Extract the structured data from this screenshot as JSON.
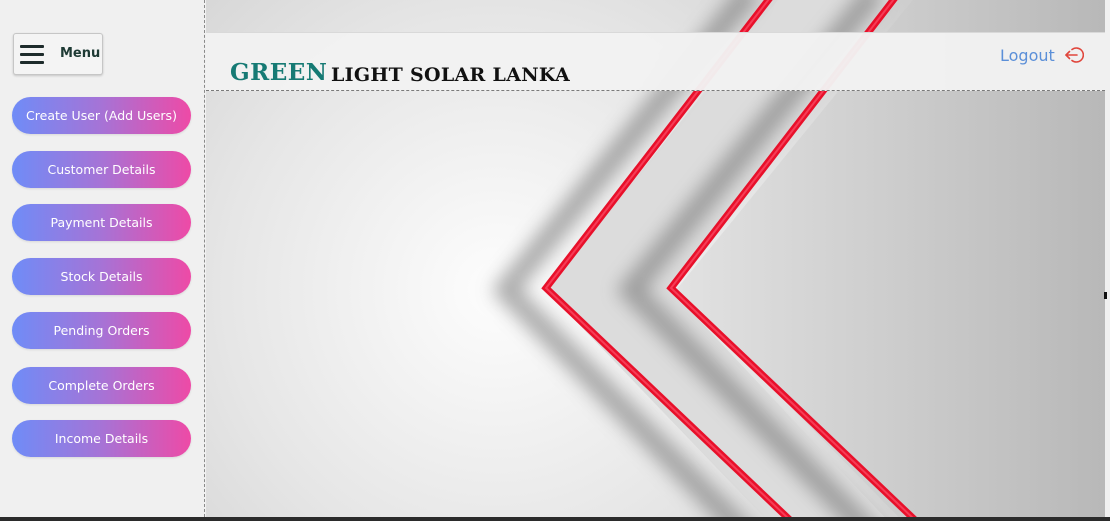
{
  "sidebar": {
    "menu_label": "Menu",
    "items": [
      {
        "label": "Create User (Add Users)"
      },
      {
        "label": "Customer Details"
      },
      {
        "label": "Payment Details"
      },
      {
        "label": "Stock Details"
      },
      {
        "label": "Pending Orders"
      },
      {
        "label": "Complete Orders"
      },
      {
        "label": "Income Details"
      }
    ]
  },
  "header": {
    "brand_highlight": "GREEN",
    "brand_rest": "LIGHT SOLAR LANKA",
    "logout_label": "Logout",
    "logout_icon": "logout-icon"
  },
  "colors": {
    "brand_green": "#167a74",
    "logout_blue": "#5b8fd8",
    "logout_icon_red": "#e0463c",
    "nav_gradient_start": "#6f8cf7",
    "nav_gradient_end": "#ee4aa6",
    "chevron_red": "#e8102a"
  }
}
